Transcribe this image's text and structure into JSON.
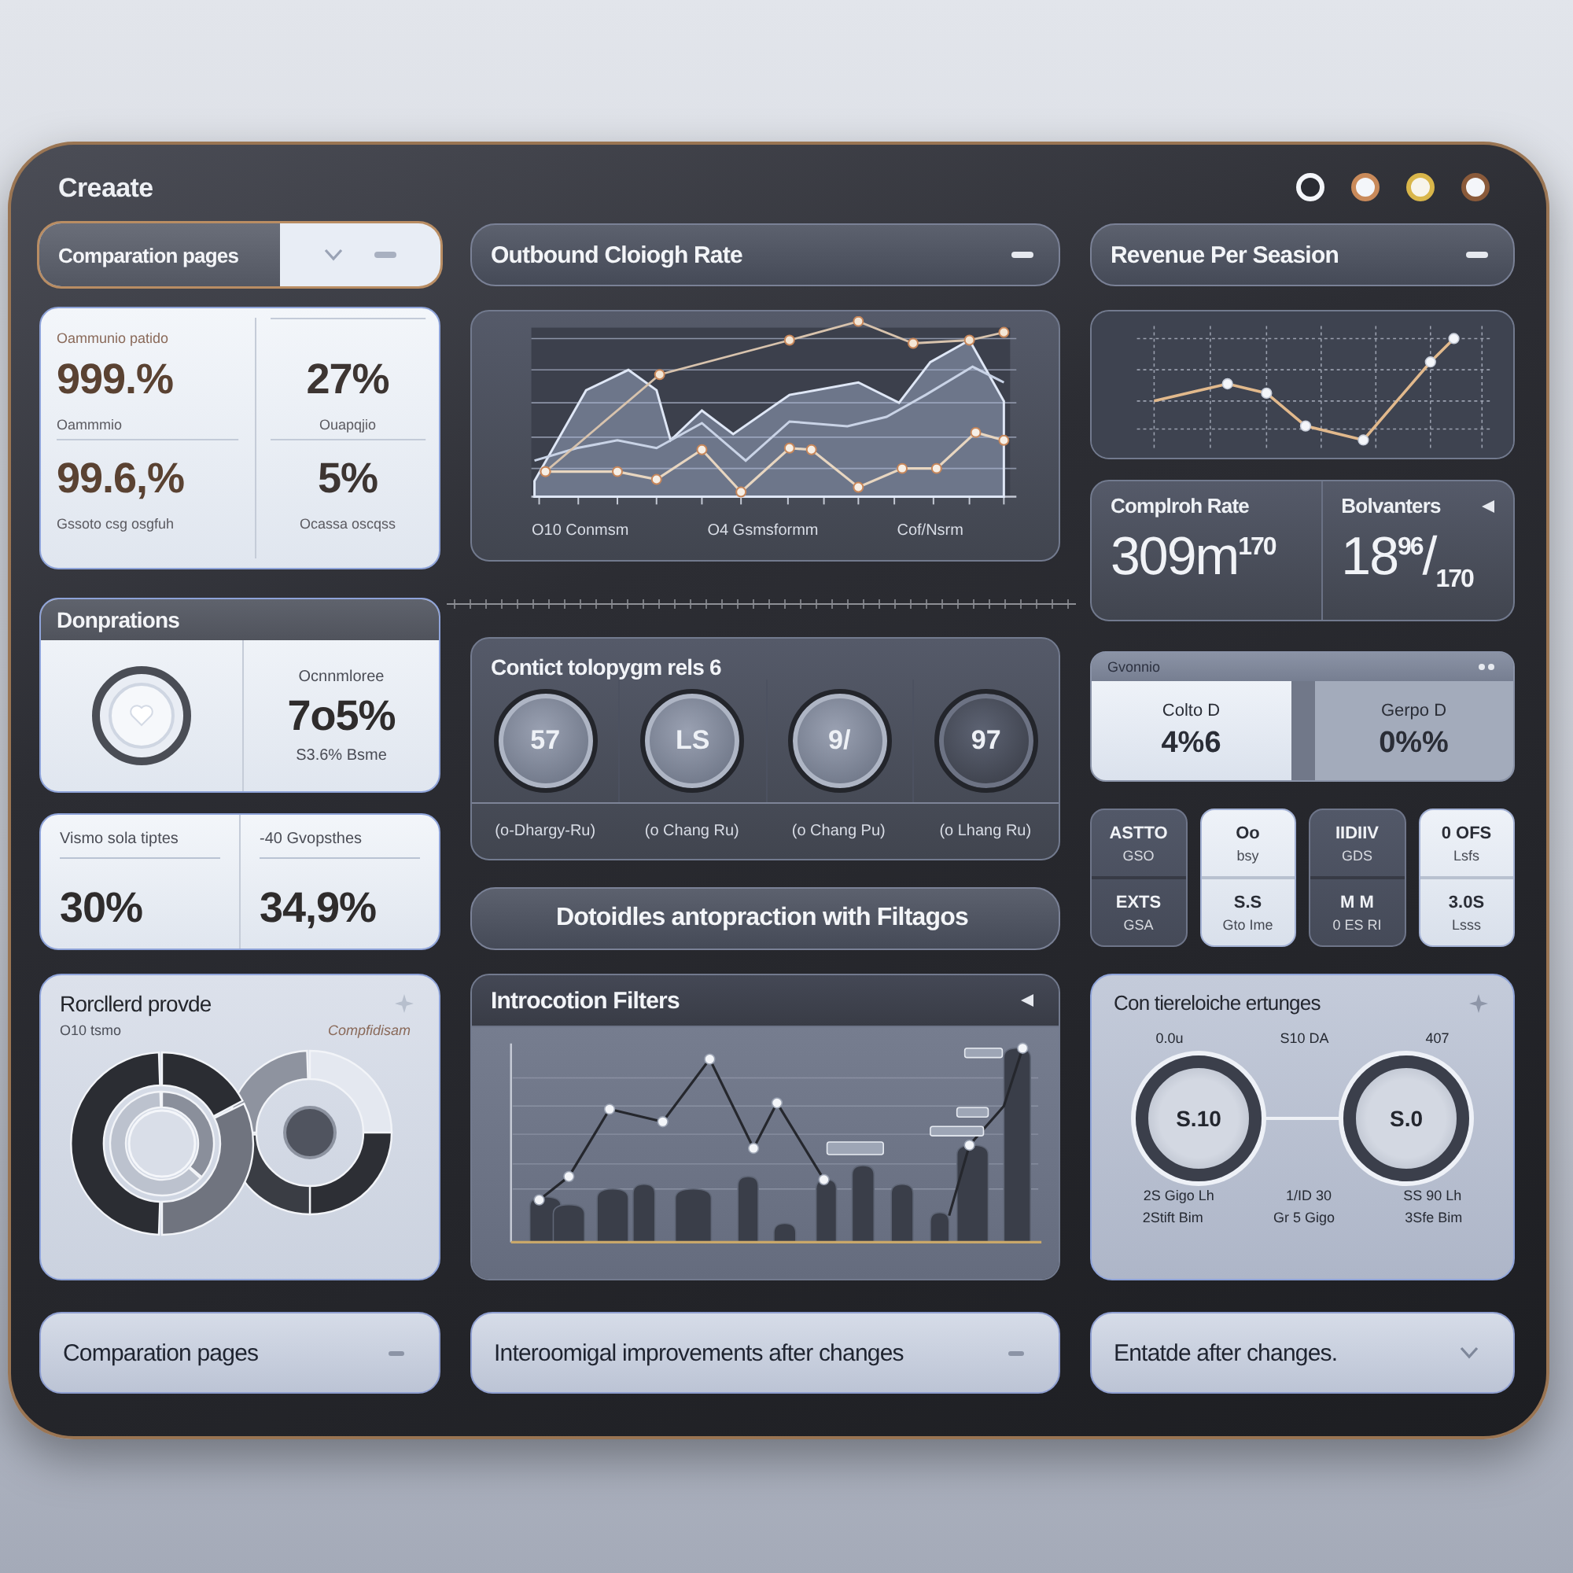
{
  "window": {
    "title": "Creaate"
  },
  "left": {
    "select": {
      "label": "Comparation pages"
    },
    "stats": {
      "cells": [
        {
          "label": "Oammunio patido",
          "value": "999.%",
          "caption": "Oammmio"
        },
        {
          "value": "27%",
          "caption": "Ouapqjio"
        },
        {
          "value": "99.6,%",
          "caption": "Gssoto csg osgfuh"
        },
        {
          "value": "5%",
          "caption": "Ocassa oscqss"
        }
      ]
    },
    "donations": {
      "title": "Donprations",
      "label": "Ocnnmloree",
      "value": "7o5%",
      "caption": "S3.6% Bsme"
    },
    "split_stats": [
      {
        "label": "Vismo sola tiptes",
        "value": "30%"
      },
      {
        "label": "-40 Gvopsthes",
        "value": "34,9%"
      }
    ],
    "donut_card": {
      "title": "Rorcllerd provde",
      "note_left": "O10 tsmo",
      "note_right": "Compfidisam"
    },
    "footer_select": {
      "label": "Comparation pages"
    }
  },
  "middle": {
    "select": {
      "label": "Outbound Cloiogh Rate"
    },
    "line_chart": {
      "captions": [
        "O10 Conmsm",
        "O4 Gsmsformm",
        "Cof/Nsrm"
      ]
    },
    "gauges_card": {
      "title": "Contict tolopygm rels 6",
      "gauges": [
        {
          "value": "57",
          "caption": "(o-Dhargy-Ru)",
          "highlighted": false
        },
        {
          "value": "LS",
          "caption": "(o Chang Ru)",
          "highlighted": false
        },
        {
          "value": "9/",
          "caption": "(o Chang Pu)",
          "highlighted": false
        },
        {
          "value": "97",
          "caption": "(o Lhang Ru)",
          "highlighted": true
        }
      ]
    },
    "action_button": {
      "label": "Dotoidles antopraction with Filtagos"
    },
    "filters_chart": {
      "title": "Introcotion Filters"
    },
    "footer_select": {
      "label": "Interoomigal improvements after changes"
    }
  },
  "right": {
    "select": {
      "label": "Revenue Per Seasion"
    },
    "metrics": [
      {
        "label": "Complroh Rate",
        "value": "309m$^{170}$"
      },
      {
        "label": "Bolvanters",
        "value": "18$^{96}$/$_{170}$"
      }
    ],
    "segments": {
      "title": "Gvonnio",
      "options": [
        {
          "label": "Colto D",
          "value": "4%6",
          "selected": true
        },
        {
          "label": "Gerpo D",
          "value": "0%%",
          "selected": false
        }
      ]
    },
    "tile_columns": [
      {
        "highlighted": false,
        "tiles": [
          {
            "value": "ASTTO",
            "caption": "GSO"
          },
          {
            "value": "EXTS",
            "caption": "GSA"
          }
        ]
      },
      {
        "highlighted": true,
        "tiles": [
          {
            "value": "Oo",
            "caption": "bsy"
          },
          {
            "value": "S.S",
            "caption": "Gto Ime"
          }
        ]
      },
      {
        "highlighted": false,
        "tiles": [
          {
            "value": "IIDIIV",
            "caption": "GDS"
          },
          {
            "value": "M M",
            "caption": "0 ES RI"
          }
        ]
      },
      {
        "highlighted": true,
        "tiles": [
          {
            "value": "0 OFS",
            "caption": "Lsfs"
          },
          {
            "value": "3.0S",
            "caption": "Lsss"
          }
        ]
      }
    ],
    "pair_card": {
      "title": "Con tiereloiche ertunges",
      "top_labels": [
        "0.0u",
        "S10 DA",
        "407"
      ],
      "dials": [
        {
          "value": "S.10"
        },
        {
          "value": "S.0"
        }
      ],
      "bottom_rows": [
        [
          "2S Gigo Lh",
          "1/ID 30",
          "SS 90 Lh"
        ],
        [
          "2Stift Bim",
          "Gr 5 Gigo",
          "3Sfe Bim"
        ]
      ]
    },
    "footer_select": {
      "label": "Entatde after changes."
    }
  }
}
